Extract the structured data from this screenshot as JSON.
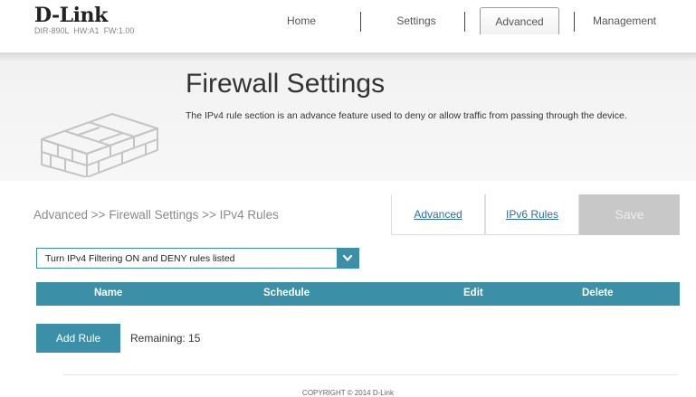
{
  "brand": {
    "logo": "D-Link",
    "model": "DIR-890L",
    "hw": "HW:A1",
    "fw": "FW:1.00"
  },
  "nav": {
    "items": [
      {
        "label": "Home"
      },
      {
        "label": "Settings"
      },
      {
        "label": "Advanced"
      },
      {
        "label": "Management"
      }
    ],
    "active": "Advanced"
  },
  "banner": {
    "title": "Firewall Settings",
    "description": "The IPv4 rule section is an advance feature used to deny or allow traffic from passing through the device."
  },
  "breadcrumb": "Advanced >> Firewall Settings >> IPv4 Rules",
  "tabs": [
    {
      "label": "Advanced"
    },
    {
      "label": "IPv6 Rules"
    }
  ],
  "save_label": "Save",
  "filter_select": {
    "value": "Turn IPv4 Filtering ON and DENY rules listed"
  },
  "table": {
    "columns": [
      "Name",
      "Schedule",
      "Edit",
      "Delete"
    ]
  },
  "add_rule_label": "Add Rule",
  "remaining_text": "Remaining: 15",
  "copyright": "COPYRIGHT © 2014 D-Link",
  "colors": {
    "accent": "#3b8fa6",
    "save_disabled": "#c8c8c8",
    "link": "#2c6e9c"
  }
}
